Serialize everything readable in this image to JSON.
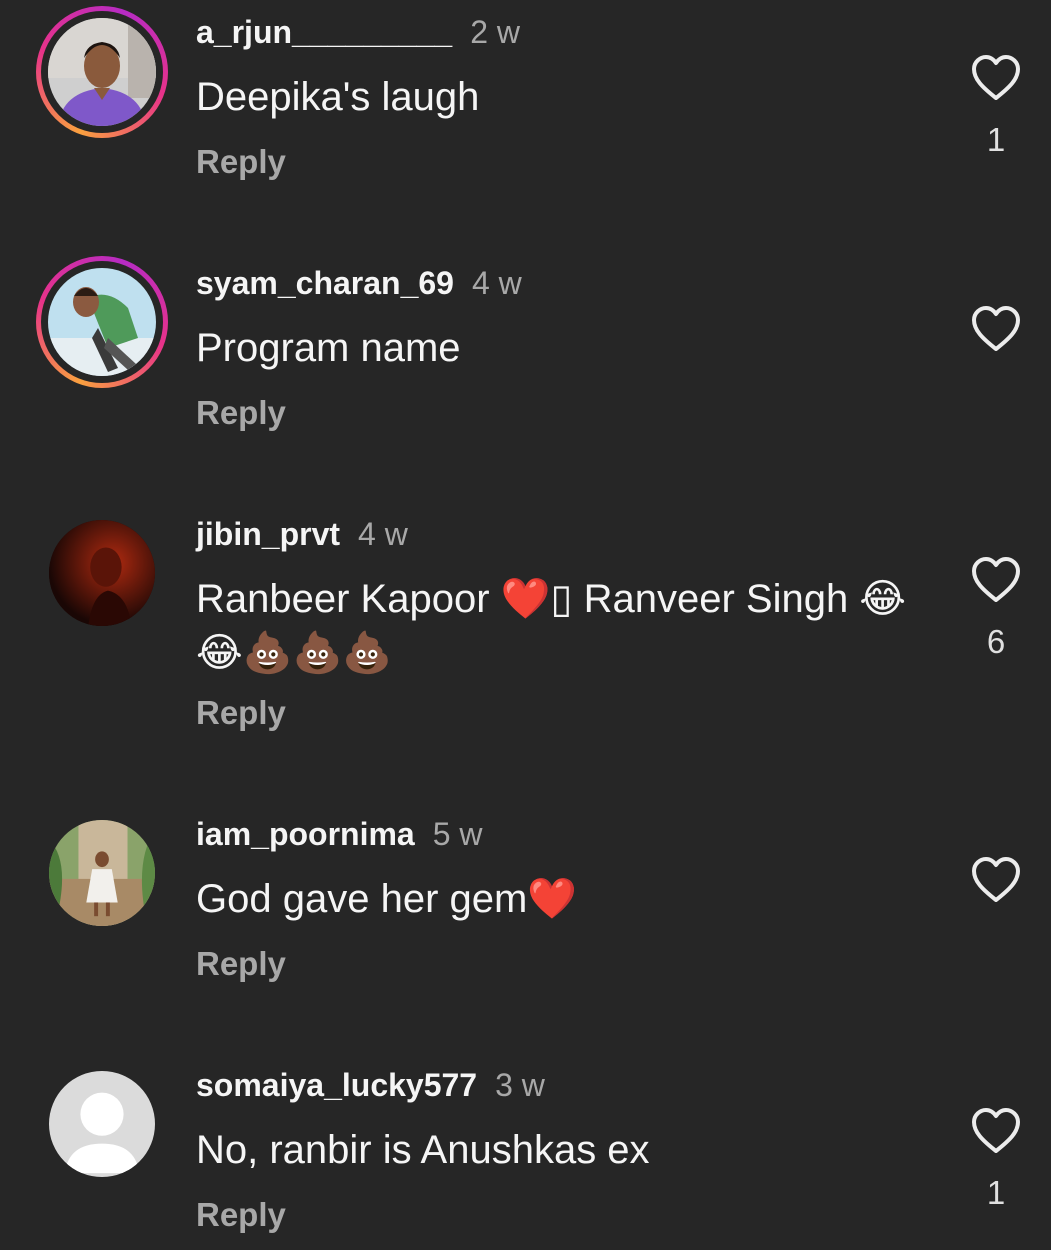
{
  "comments": [
    {
      "username": "a_rjun_________",
      "time": "2 w",
      "text": "Deepika's laugh",
      "reply": "Reply",
      "likes": "1",
      "avatar": "man-purple-shirt",
      "story_ring": true
    },
    {
      "username": "syam_charan_69",
      "time": "4 w",
      "text": "Program name",
      "reply": "Reply",
      "likes": "",
      "avatar": "man-green-jacket",
      "story_ring": true
    },
    {
      "username": "jibin_prvt",
      "time": "4 w",
      "text_line1": "Ranbeer Kapoor ❤️▯ Ranveer Singh 😂",
      "text_line2": "😂💩💩💩",
      "reply": "Reply",
      "likes": "6",
      "avatar": "dark-red-portrait",
      "story_ring": false
    },
    {
      "username": "iam_poornima",
      "time": "5 w",
      "text": "God gave her gem❤️",
      "reply": "Reply",
      "likes": "",
      "avatar": "woman-white-dress",
      "story_ring": false
    },
    {
      "username": "somaiya_lucky577",
      "time": "3 w",
      "text": "No, ranbir is Anushkas ex",
      "reply": "Reply",
      "likes": "1",
      "avatar": "default-user",
      "story_ring": false
    }
  ],
  "colors": {
    "background": "#262626",
    "primary_text": "#f5f5f5",
    "secondary_text": "#a8a8a8",
    "story_ring_gradient": [
      "#f9a03f",
      "#e7328a",
      "#b62bc4"
    ]
  },
  "icons": {
    "like": "heart-outline-icon"
  }
}
